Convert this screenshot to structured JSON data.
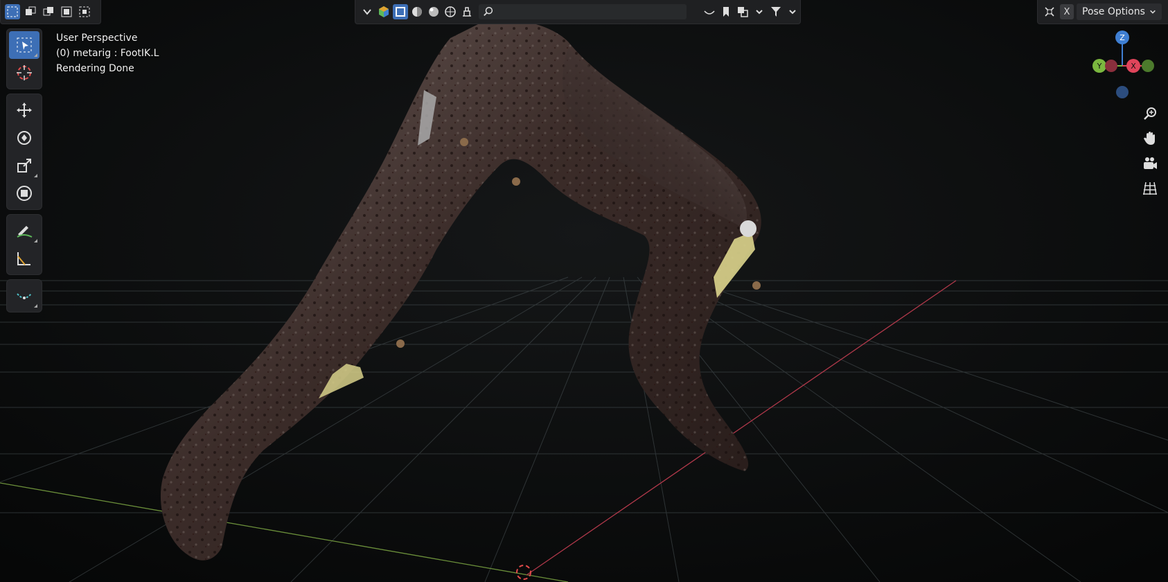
{
  "header": {
    "search_placeholder": "",
    "pose_options_label": "Pose Options",
    "close_label": "X"
  },
  "overlay": {
    "view_name": "User Perspective",
    "active_object": "(0) metarig : FootIK.L",
    "status": "Rendering Done"
  },
  "gizmo": {
    "z_label": "Z",
    "y_label": "Y",
    "x_label": "X"
  },
  "colors": {
    "accent": "#3d6fb6",
    "x_axis": "#e0455b",
    "y_axis": "#7bb73f",
    "z_axis": "#3f7fd3",
    "bone": "#d7d08a"
  },
  "icons": {
    "tools": [
      "select-box-icon",
      "cursor-icon",
      "move-icon",
      "rotate-icon",
      "scale-icon",
      "transform-icon",
      "annotate-icon",
      "measure-icon",
      "relax-icon"
    ],
    "nav": [
      "zoom-icon",
      "pan-hand-icon",
      "camera-icon",
      "ortho-grid-icon"
    ]
  }
}
